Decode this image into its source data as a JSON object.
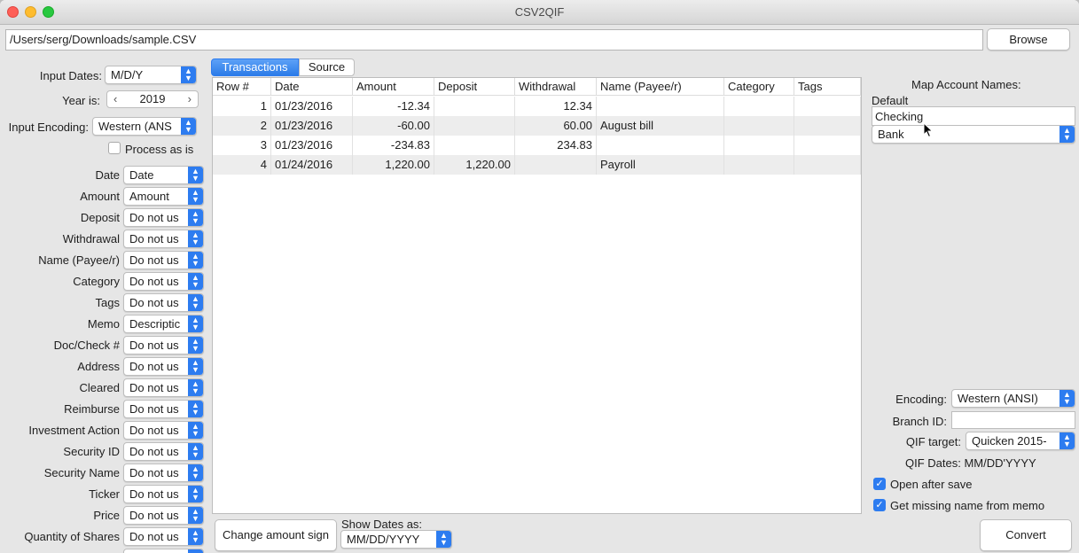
{
  "window": {
    "title": "CSV2QIF"
  },
  "file": {
    "path": "/Users/serg/Downloads/sample.CSV",
    "browse_label": "Browse"
  },
  "settings": {
    "input_dates_label": "Input Dates:",
    "input_dates_value": "M/D/Y",
    "year_label": "Year is:",
    "year_value": "2019",
    "input_encoding_label": "Input Encoding:",
    "input_encoding_value": "Western (ANS",
    "process_as_is_label": "Process as is"
  },
  "field_map": [
    {
      "label": "Date",
      "value": "Date"
    },
    {
      "label": "Amount",
      "value": "Amount"
    },
    {
      "label": "Deposit",
      "value": "Do not us"
    },
    {
      "label": "Withdrawal",
      "value": "Do not us"
    },
    {
      "label": "Name (Payee/r)",
      "value": "Do not us"
    },
    {
      "label": "Category",
      "value": "Do not us"
    },
    {
      "label": "Tags",
      "value": "Do not us"
    },
    {
      "label": "Memo",
      "value": "Descriptic"
    },
    {
      "label": "Doc/Check #",
      "value": "Do not us"
    },
    {
      "label": "Address",
      "value": "Do not us"
    },
    {
      "label": "Cleared",
      "value": "Do not us"
    },
    {
      "label": "Reimburse",
      "value": "Do not us"
    },
    {
      "label": "Investment Action",
      "value": "Do not us"
    },
    {
      "label": "Security ID",
      "value": "Do not us"
    },
    {
      "label": "Security Name",
      "value": "Do not us"
    },
    {
      "label": "Ticker",
      "value": "Do not us"
    },
    {
      "label": "Price",
      "value": "Do not us"
    },
    {
      "label": "Quantity of Shares",
      "value": "Do not us"
    }
  ],
  "tabs": [
    {
      "label": "Transactions",
      "active": true
    },
    {
      "label": "Source",
      "active": false
    }
  ],
  "table": {
    "columns": [
      "Row #",
      "Date",
      "Amount",
      "Deposit",
      "Withdrawal",
      "Name (Payee/r)",
      "Category",
      "Tags"
    ],
    "rows": [
      [
        "1",
        "01/23/2016",
        "-12.34",
        "",
        "12.34",
        "",
        "",
        ""
      ],
      [
        "2",
        "01/23/2016",
        "-60.00",
        "",
        "60.00",
        "August bill",
        "",
        ""
      ],
      [
        "3",
        "01/23/2016",
        "-234.83",
        "",
        "234.83",
        "",
        "",
        ""
      ],
      [
        "4",
        "01/24/2016",
        "1,220.00",
        "1,220.00",
        "",
        "Payroll",
        "",
        ""
      ]
    ]
  },
  "bottom": {
    "change_sign_label": "Change amount sign",
    "show_dates_label": "Show Dates as:",
    "show_dates_value": "MM/DD/YYYY"
  },
  "right_panel": {
    "map_title": "Map Account Names:",
    "default_label": "Default",
    "account_value": "Checking",
    "account_type_value": "Bank",
    "encoding_label": "Encoding:",
    "encoding_value": "Western (ANSI)",
    "branch_label": "Branch ID:",
    "branch_value": "",
    "qif_target_label": "QIF target:",
    "qif_target_value": "Quicken 2015-",
    "qif_dates_text": "QIF Dates: MM/DD'YYYY",
    "open_after_save_label": "Open after save",
    "open_after_save_checked": true,
    "missing_name_label": "Get missing name from memo",
    "missing_name_checked": true,
    "convert_label": "Convert"
  },
  "colors": {
    "accent": "#2d7cf0",
    "alt_row": "#ededed"
  }
}
